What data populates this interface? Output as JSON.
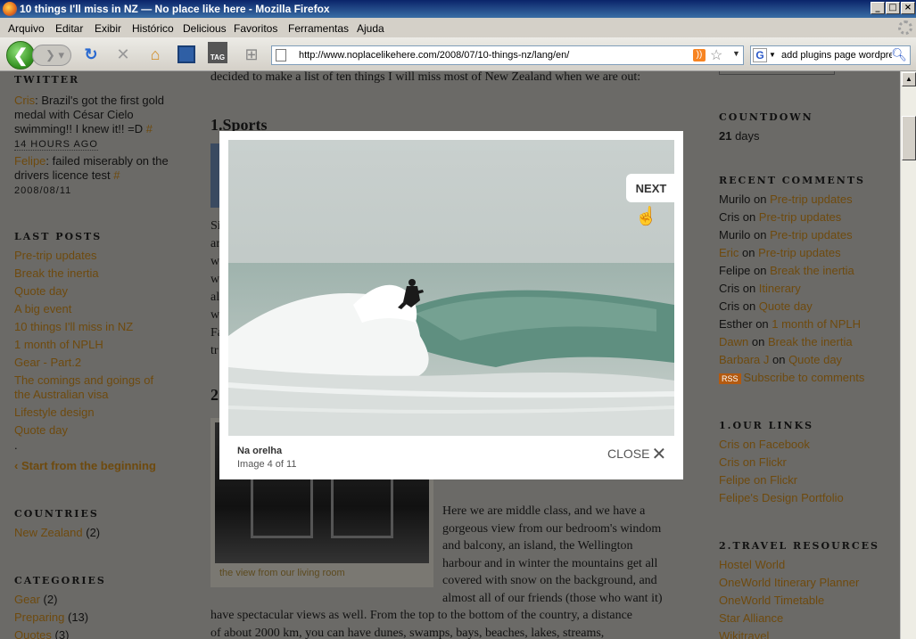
{
  "window": {
    "title": "10 things I'll miss in NZ — No place like here - Mozilla Firefox",
    "min": "_",
    "max": "□",
    "close": "×"
  },
  "menu": [
    "Arquivo",
    "Editar",
    "Exibir",
    "Histórico",
    "Delicious",
    "Favoritos",
    "Ferramentas",
    "Ajuda"
  ],
  "nav": {
    "url": "http://www.noplacelikehere.com/2008/07/10-things-nz/lang/en/",
    "search_text": "add plugins page wordpress",
    "tag_label": "TAG"
  },
  "left_sidebar": {
    "twitter_heading": "TWITTER",
    "tweets": [
      {
        "author": "Cris",
        "text": ": Brazil's got the first gold medal with César Cielo swimming!! I knew it!! =D",
        "hash": "#",
        "time": "14 HOURS AGO"
      },
      {
        "author": "Felipe",
        "text": ": failed miserably on the drivers licence test",
        "hash": "#",
        "time": "2008/08/11"
      }
    ],
    "last_posts_heading": "LAST POSTS",
    "last_posts": [
      "Pre-trip updates",
      "Break the inertia",
      "Quote day",
      "A big event",
      "10 things I'll miss in NZ",
      "1 month of NPLH",
      "Gear - Part.2",
      "The comings and goings of",
      "the Australian visa",
      "Lifestyle design",
      "Quote day"
    ],
    "dot": ".",
    "start_link": "‹ Start from the beginning",
    "countries_heading": "COUNTRIES",
    "countries": [
      {
        "name": "New Zealand",
        "count": "(2)"
      }
    ],
    "categories_heading": "CATEGORIES",
    "categories": [
      {
        "name": "Gear",
        "count": "(2)"
      },
      {
        "name": "Preparing",
        "count": "(13)"
      },
      {
        "name": "Quotes",
        "count": "(3)"
      }
    ]
  },
  "main": {
    "intro_tail": "decided to make a list of ten things I will miss most of New Zealand when we are out:",
    "heading1": "1.Sports",
    "heading2": "2",
    "photo_caption": "the view from our living room",
    "para2": [
      "Here we are middle class, and we have a",
      "gorgeous view from our bedroom's windom",
      "and balcony, an island, the Wellington",
      "harbour and in winter the mountains get all",
      "covered with snow on the background, and",
      "almost all of our friends (those who want it)"
    ],
    "para2_full": [
      "have spectacular views as well. From the top to the bottom of the country, a distance",
      "of about 2000 km, you can have dunes, swamps, bays, beaches, lakes, streams,"
    ],
    "left_fragments": [
      "Si",
      "ar",
      "w",
      "w",
      "al",
      "w",
      "Fa",
      "tr"
    ]
  },
  "right_sidebar": {
    "countdown_heading": "COUNTDOWN",
    "countdown_num": "21",
    "countdown_unit": " days",
    "recent_heading": "RECENT COMMENTS",
    "comments": [
      {
        "who": "Murilo",
        "on": " on ",
        "post": "Pre-trip updates"
      },
      {
        "who": "Cris",
        "on": " on ",
        "post": "Pre-trip updates"
      },
      {
        "who": "Murilo",
        "on": " on ",
        "post": "Pre-trip updates"
      },
      {
        "who": "Eric",
        "on": " on ",
        "post": "Pre-trip updates"
      },
      {
        "who": "Felipe",
        "on": " on ",
        "post": "Break the inertia"
      },
      {
        "who": "Cris",
        "on": " on ",
        "post": "Itinerary"
      },
      {
        "who": "Cris",
        "on": " on ",
        "post": "Quote day"
      },
      {
        "who": "Esther",
        "on": " on ",
        "post": "1 month of NPLH"
      },
      {
        "who": "Dawn",
        "on": " on ",
        "post": "Break the inertia"
      },
      {
        "who": "Barbara J",
        "on": " on ",
        "post": "Quote day"
      }
    ],
    "rss_badge": "RSS",
    "subscribe": "Subscribe to comments",
    "links_heading": "1.OUR LINKS",
    "links": [
      "Cris on Facebook",
      "Cris on Flickr",
      "Felipe on Flickr",
      "Felipe's Design Portfolio"
    ],
    "travel_heading": "2.TRAVEL RESOURCES",
    "travel": [
      "Hostel World",
      "OneWorld Itinerary Planner",
      "OneWorld Timetable",
      "Star Alliance",
      "Wikitravel"
    ]
  },
  "lightbox": {
    "next": "NEXT",
    "caption": "Na orelha",
    "counter": "Image 4 of 11",
    "close": "CLOSE"
  }
}
